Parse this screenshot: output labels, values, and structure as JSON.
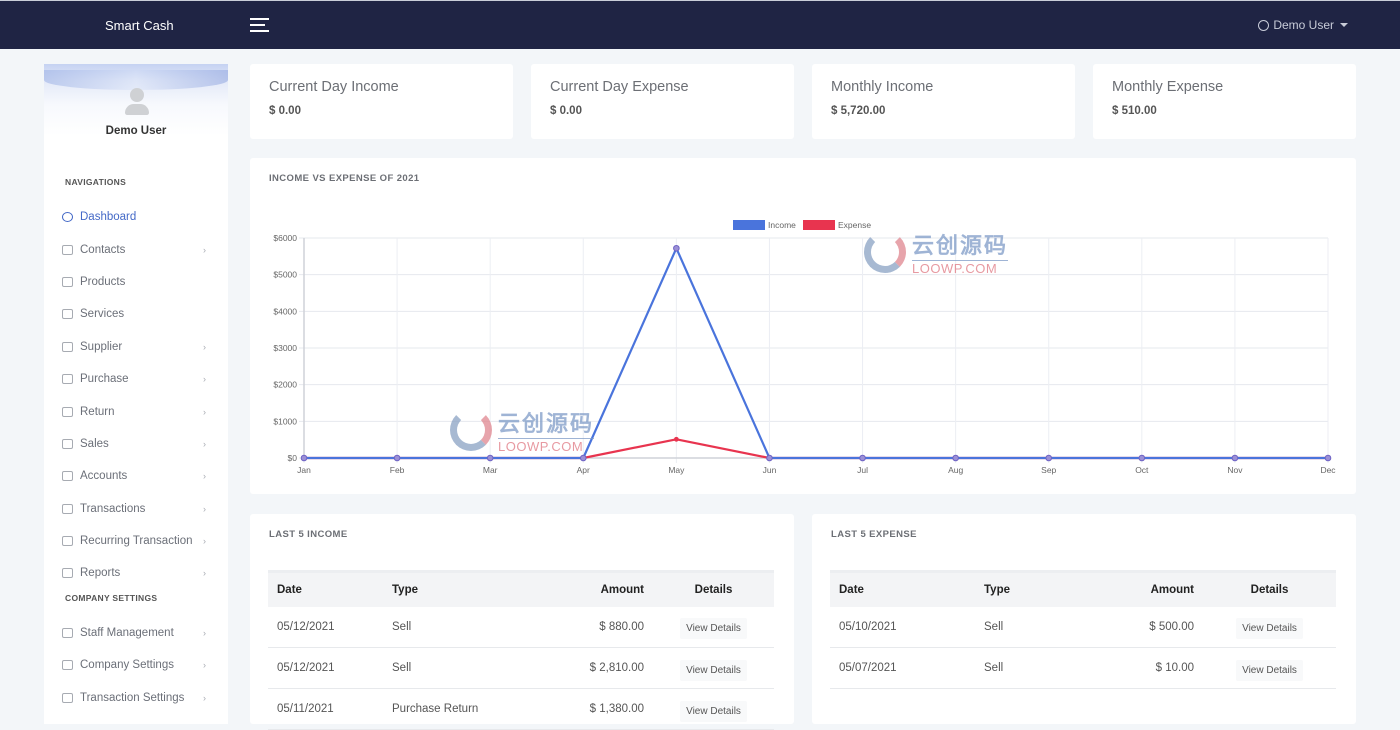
{
  "app": {
    "brand": "Smart Cash",
    "user_menu_label": "Demo User"
  },
  "sidebar": {
    "profile_name": "Demo User",
    "sections": [
      {
        "title": "NAVIGATIONS",
        "items": [
          {
            "label": "Dashboard",
            "icon": "dashboard-icon",
            "active": true,
            "has_children": false
          },
          {
            "label": "Contacts",
            "icon": "contacts-icon",
            "has_children": true
          },
          {
            "label": "Products",
            "icon": "products-icon",
            "has_children": false
          },
          {
            "label": "Services",
            "icon": "services-icon",
            "has_children": false
          },
          {
            "label": "Supplier",
            "icon": "supplier-icon",
            "has_children": true
          },
          {
            "label": "Purchase",
            "icon": "purchase-icon",
            "has_children": true
          },
          {
            "label": "Return",
            "icon": "return-icon",
            "has_children": true
          },
          {
            "label": "Sales",
            "icon": "sales-icon",
            "has_children": true
          },
          {
            "label": "Accounts",
            "icon": "accounts-icon",
            "has_children": true
          },
          {
            "label": "Transactions",
            "icon": "transactions-icon",
            "has_children": true
          },
          {
            "label": "Recurring Transaction",
            "icon": "recurring-icon",
            "has_children": true
          },
          {
            "label": "Reports",
            "icon": "reports-icon",
            "has_children": true
          }
        ]
      },
      {
        "title": "COMPANY SETTINGS",
        "items": [
          {
            "label": "Staff Management",
            "icon": "staff-icon",
            "has_children": true
          },
          {
            "label": "Company Settings",
            "icon": "sliders-icon",
            "has_children": true
          },
          {
            "label": "Transaction Settings",
            "icon": "transaction-settings-icon",
            "has_children": true
          }
        ]
      }
    ]
  },
  "stats": [
    {
      "title": "Current Day Income",
      "value": "$ 0.00"
    },
    {
      "title": "Current Day Expense",
      "value": "$ 0.00"
    },
    {
      "title": "Monthly Income",
      "value": "$ 5,720.00"
    },
    {
      "title": "Monthly Expense",
      "value": "$ 510.00"
    }
  ],
  "chart_card": {
    "title": "INCOME VS EXPENSE OF 2021"
  },
  "chart_data": {
    "type": "line",
    "title": "INCOME VS EXPENSE OF 2021",
    "categories": [
      "Jan",
      "Feb",
      "Mar",
      "Apr",
      "May",
      "Jun",
      "Jul",
      "Aug",
      "Sep",
      "Oct",
      "Nov",
      "Dec"
    ],
    "series": [
      {
        "name": "Income",
        "color": "#4a74dc",
        "values": [
          0,
          0,
          0,
          0,
          5720,
          0,
          0,
          0,
          0,
          0,
          0,
          0
        ]
      },
      {
        "name": "Expense",
        "color": "#e8344f",
        "values": [
          0,
          0,
          0,
          0,
          510,
          0,
          0,
          0,
          0,
          0,
          0,
          0
        ]
      }
    ],
    "yticks": [
      0,
      1000,
      2000,
      3000,
      4000,
      5000,
      6000
    ],
    "ytick_labels": [
      "$0",
      "$1000",
      "$2000",
      "$3000",
      "$4000",
      "$5000",
      "$6000"
    ],
    "ylim": [
      0,
      6000
    ],
    "xlabel": "",
    "ylabel": "",
    "legend": "top-center",
    "grid": true
  },
  "income_table": {
    "title": "LAST 5 INCOME",
    "columns": [
      "Date",
      "Type",
      "Amount",
      "Details"
    ],
    "rows": [
      {
        "date": "05/12/2021",
        "type": "Sell",
        "amount": "$ 880.00",
        "action": "View Details"
      },
      {
        "date": "05/12/2021",
        "type": "Sell",
        "amount": "$ 2,810.00",
        "action": "View Details"
      },
      {
        "date": "05/11/2021",
        "type": "Purchase Return",
        "amount": "$ 1,380.00",
        "action": "View Details"
      }
    ]
  },
  "expense_table": {
    "title": "LAST 5 EXPENSE",
    "columns": [
      "Date",
      "Type",
      "Amount",
      "Details"
    ],
    "rows": [
      {
        "date": "05/10/2021",
        "type": "Sell",
        "amount": "$ 500.00",
        "action": "View Details"
      },
      {
        "date": "05/07/2021",
        "type": "Sell",
        "amount": "$ 10.00",
        "action": "View Details"
      }
    ]
  },
  "watermark": {
    "cn": "云创源码",
    "en": "LOOWP.COM"
  }
}
